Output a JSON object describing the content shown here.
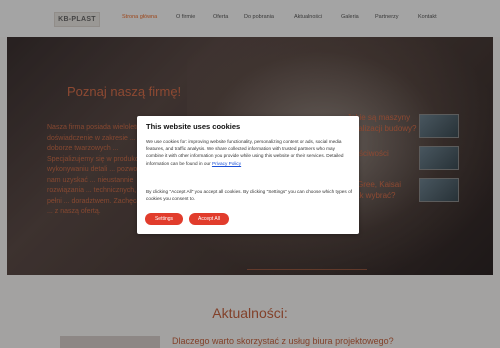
{
  "nav": {
    "logo": "KB-PLAST",
    "items": [
      {
        "label": "Strona główna",
        "active": true
      },
      {
        "label": "O firmie"
      },
      {
        "label": "Oferta"
      },
      {
        "label": "Do pobrania"
      },
      {
        "label": "Aktualności"
      },
      {
        "label": "Galeria"
      },
      {
        "label": "Partnerzy"
      },
      {
        "label": "Kontakt"
      }
    ]
  },
  "hero": {
    "title": "Poznaj naszą firmę!",
    "text": "Nasza firma posiada wieloletnie doświadczenie w zakresie ... i doborze twarzowych ... Specjalizujemy się w produkcji ... wykonywaniu detali ... pozwolile nam uzyskać ... nieustannie rozwiązania ... technicznych, w pełni ... doradztwem. Zachęcamy ... z naszą ofertą.",
    "side_items": [
      "Jakie są maszyny",
      "do realizacji budowy?",
      "właściwości",
      "Gree, Kaisai",
      "Jak wybrać?"
    ]
  },
  "cookie": {
    "title": "This website uses cookies",
    "body1": "We use cookies for: improving website functionality, personalizing content or ads, social media features, and traffic analysis. We share collected information with trusted partners who may combine it with other information you provide while using this website or their services. Detailed information can be found in our",
    "link": "Privacy Policy",
    "body2": "By clicking \"Accept All\" you accept all cookies. By clicking \"Settings\" you can choose which types of cookies you consent to.",
    "settings_label": "Settings",
    "accept_label": "Accept All"
  },
  "news": {
    "heading": "Aktualności:",
    "first_title": "Dlaczego warto skorzystać z usług biura projektowego?"
  },
  "colors": {
    "accent": "#e66a2a",
    "button": "#e13c2c"
  }
}
